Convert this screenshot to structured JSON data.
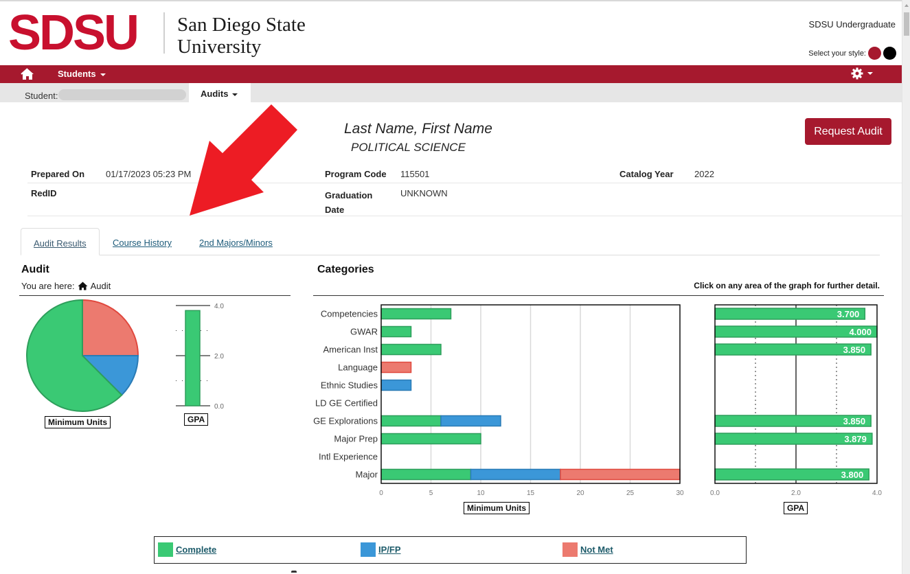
{
  "header": {
    "logo_mark": "SDSU",
    "logo_name_line1": "San Diego State",
    "logo_name_line2": "University",
    "institution": "SDSU Undergraduate",
    "style_selector_label": "Select your style:",
    "style_options": [
      {
        "name": "red",
        "color": "#a6192e"
      },
      {
        "name": "black",
        "color": "#000000"
      }
    ]
  },
  "navbar": {
    "home_icon": "home-icon",
    "students_label": "Students",
    "settings_icon": "gear-icon"
  },
  "subbar": {
    "student_label": "Student:",
    "audits_label": "Audits"
  },
  "student": {
    "name": "Last Name, First Name",
    "major": "POLITICAL SCIENCE",
    "request_audit_label": "Request Audit"
  },
  "info": {
    "prepared_on_label": "Prepared On",
    "prepared_on_value": "01/17/2023 05:23 PM",
    "redid_label": "RedID",
    "redid_value": "",
    "program_code_label": "Program Code",
    "program_code_value": "115501",
    "graduation_date_label_1": "Graduation",
    "graduation_date_label_2": "Date",
    "graduation_date_value": "UNKNOWN",
    "catalog_year_label": "Catalog Year",
    "catalog_year_value": "2022"
  },
  "tabs": [
    {
      "label": "Audit Results",
      "active": true
    },
    {
      "label": "Course History",
      "active": false
    },
    {
      "label": "2nd Majors/Minors",
      "active": false
    }
  ],
  "audit": {
    "heading": "Audit",
    "breadcrumb_prefix": "You are here:",
    "breadcrumb_current": "Audit"
  },
  "categories": {
    "heading": "Categories",
    "hint": "Click on any area of the graph for further detail."
  },
  "colors": {
    "complete": "#3ac974",
    "complete_border": "#2e9e5b",
    "ip": "#3b97d8",
    "ip_border": "#2a7bb5",
    "not_met": "#ec7a6f",
    "not_met_border": "#e0483e",
    "brand": "#a6192e",
    "logo_red": "#c8102e"
  },
  "legend": [
    {
      "key": "complete",
      "label": "Complete"
    },
    {
      "key": "ip",
      "label": "IP/FP"
    },
    {
      "key": "not_met",
      "label": "Not Met"
    }
  ],
  "chart_data": [
    {
      "type": "pie",
      "title": "",
      "xlabel": "Minimum Units",
      "slices": [
        {
          "label": "Not Met",
          "key": "not_met",
          "value": 25
        },
        {
          "label": "IP/FP",
          "key": "ip",
          "value": 12.5
        },
        {
          "label": "Complete",
          "key": "complete",
          "value": 62.5
        }
      ]
    },
    {
      "type": "bar",
      "title": "",
      "xlabel": "GPA",
      "orientation": "vertical",
      "values": [
        3.8
      ],
      "ylim": [
        0,
        4
      ],
      "yticks": [
        "0.0",
        "2.0",
        "4.0"
      ]
    },
    {
      "type": "bar",
      "orientation": "horizontal",
      "stacked": true,
      "title": "Categories",
      "xlabel": "Minimum Units",
      "xlim": [
        0,
        30
      ],
      "xticks": [
        "0",
        "5",
        "10",
        "15",
        "20",
        "25",
        "30"
      ],
      "grid": true,
      "categories": [
        "Competencies",
        "GWAR",
        "American Inst",
        "Language",
        "Ethnic Studies",
        "LD GE Certified",
        "GE Explorations",
        "Major Prep",
        "Intl Experience",
        "Major"
      ],
      "series": [
        {
          "name": "Complete",
          "key": "complete",
          "values": [
            7,
            3,
            6,
            0,
            0,
            0,
            6,
            10,
            0,
            9
          ]
        },
        {
          "name": "IP/FP",
          "key": "ip",
          "values": [
            0,
            0,
            0,
            0,
            3,
            0,
            6,
            0,
            0,
            9
          ]
        },
        {
          "name": "Not Met",
          "key": "not_met",
          "values": [
            0,
            0,
            0,
            3,
            0,
            0,
            0,
            0,
            0,
            12
          ]
        }
      ]
    },
    {
      "type": "bar",
      "orientation": "horizontal",
      "title": "",
      "xlabel": "GPA",
      "xlim": [
        0,
        4
      ],
      "xticks": [
        "0.0",
        "2.0",
        "4.0"
      ],
      "categories": [
        "Competencies",
        "GWAR",
        "American Inst",
        "Language",
        "Ethnic Studies",
        "LD GE Certified",
        "GE Explorations",
        "Major Prep",
        "Intl Experience",
        "Major"
      ],
      "values": [
        3.7,
        4.0,
        3.85,
        null,
        null,
        null,
        3.85,
        3.879,
        null,
        3.8
      ],
      "labels": [
        "3.700",
        "4.000",
        "3.850",
        "",
        "",
        "",
        "3.850",
        "3.879",
        "",
        "3.800"
      ]
    }
  ]
}
